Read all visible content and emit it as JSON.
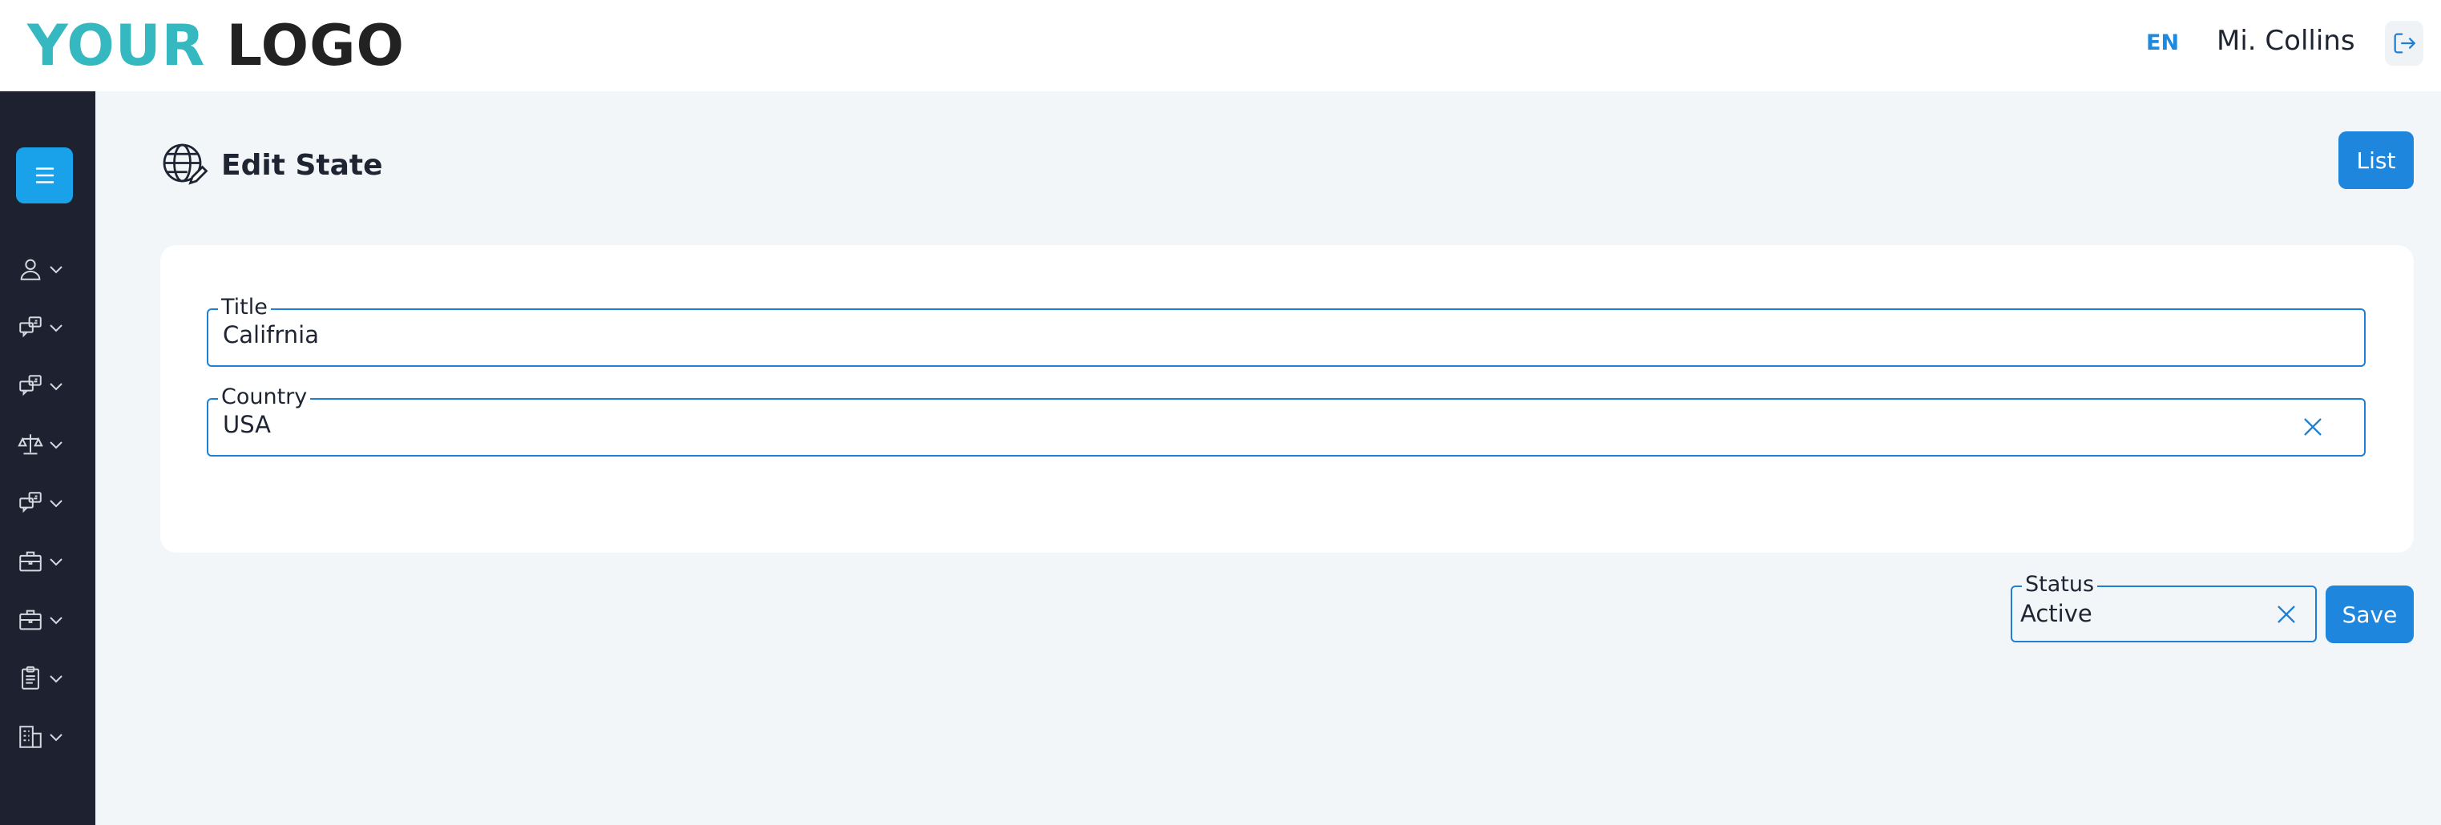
{
  "header": {
    "logo_part1": "YOUR",
    "logo_part2": "LOGO",
    "language": "EN",
    "user_name": "Mi. Collins",
    "logout_icon": "logout-icon"
  },
  "sidebar": {
    "menu_icon": "hamburger-icon",
    "items": [
      {
        "icon": "user-icon"
      },
      {
        "icon": "chat-icon"
      },
      {
        "icon": "chat-icon"
      },
      {
        "icon": "scale-icon"
      },
      {
        "icon": "chat-icon"
      },
      {
        "icon": "briefcase-icon"
      },
      {
        "icon": "briefcase-icon"
      },
      {
        "icon": "clipboard-icon"
      },
      {
        "icon": "building-icon"
      }
    ]
  },
  "page": {
    "title": "Edit State",
    "title_icon": "globe-edit-icon",
    "list_button": "List"
  },
  "form": {
    "title_label": "Title",
    "title_value": "Califrnia",
    "country_label": "Country",
    "country_value": "USA",
    "status_label": "Status",
    "status_value": "Active",
    "save_button": "Save"
  },
  "colors": {
    "accent": "#1f86de",
    "sidebar_bg": "#1e2130",
    "menu_button": "#19a2ea",
    "logo_teal": "#35b8bf",
    "page_bg": "#f3f6f9"
  }
}
